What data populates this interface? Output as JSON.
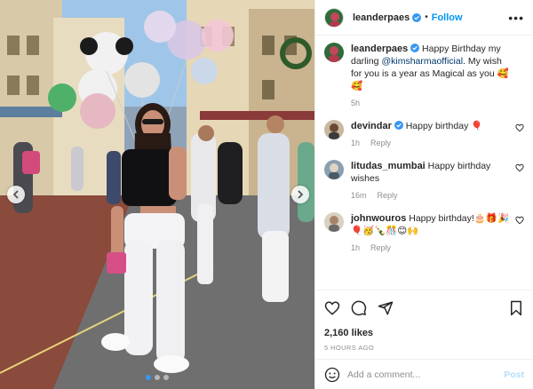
{
  "header": {
    "username": "leanderpaes",
    "follow_label": "Follow",
    "separator": "•",
    "more_label": "•••"
  },
  "caption": {
    "username": "leanderpaes",
    "text_before": "Happy Birthday my darling ",
    "mention": "@kimsharmaofficial",
    "text_after": ". My wish for you is a year as Magical as you 🥰🥰",
    "time": "5h"
  },
  "comments": [
    {
      "username": "devindar",
      "verified": true,
      "text": "Happy birthday 🎈",
      "time": "1h",
      "reply_label": "Reply"
    },
    {
      "username": "litudas_mumbai",
      "verified": false,
      "text": "Happy birthday wishes",
      "time": "16m",
      "reply_label": "Reply"
    },
    {
      "username": "johnwouros",
      "verified": false,
      "text": "Happy birthday!🎂🎁🎉🎈🥳🍾🎊😊🙌",
      "time": "1h",
      "reply_label": "Reply"
    }
  ],
  "likes": "2,160 likes",
  "time_ago": "5 HOURS AGO",
  "add_comment": {
    "placeholder": "Add a comment...",
    "post_label": "Post"
  },
  "carousel": {
    "current": 1,
    "total": 3
  },
  "colors": {
    "accent": "#0095f6",
    "verified": "#3897f0",
    "muted": "#8e8e8e",
    "link": "#00376b"
  },
  "icons": [
    "verified-badge-icon",
    "more-options-icon",
    "heart-icon",
    "comment-icon",
    "share-icon",
    "bookmark-icon",
    "emoji-icon",
    "chevron-left-icon",
    "chevron-right-icon"
  ]
}
